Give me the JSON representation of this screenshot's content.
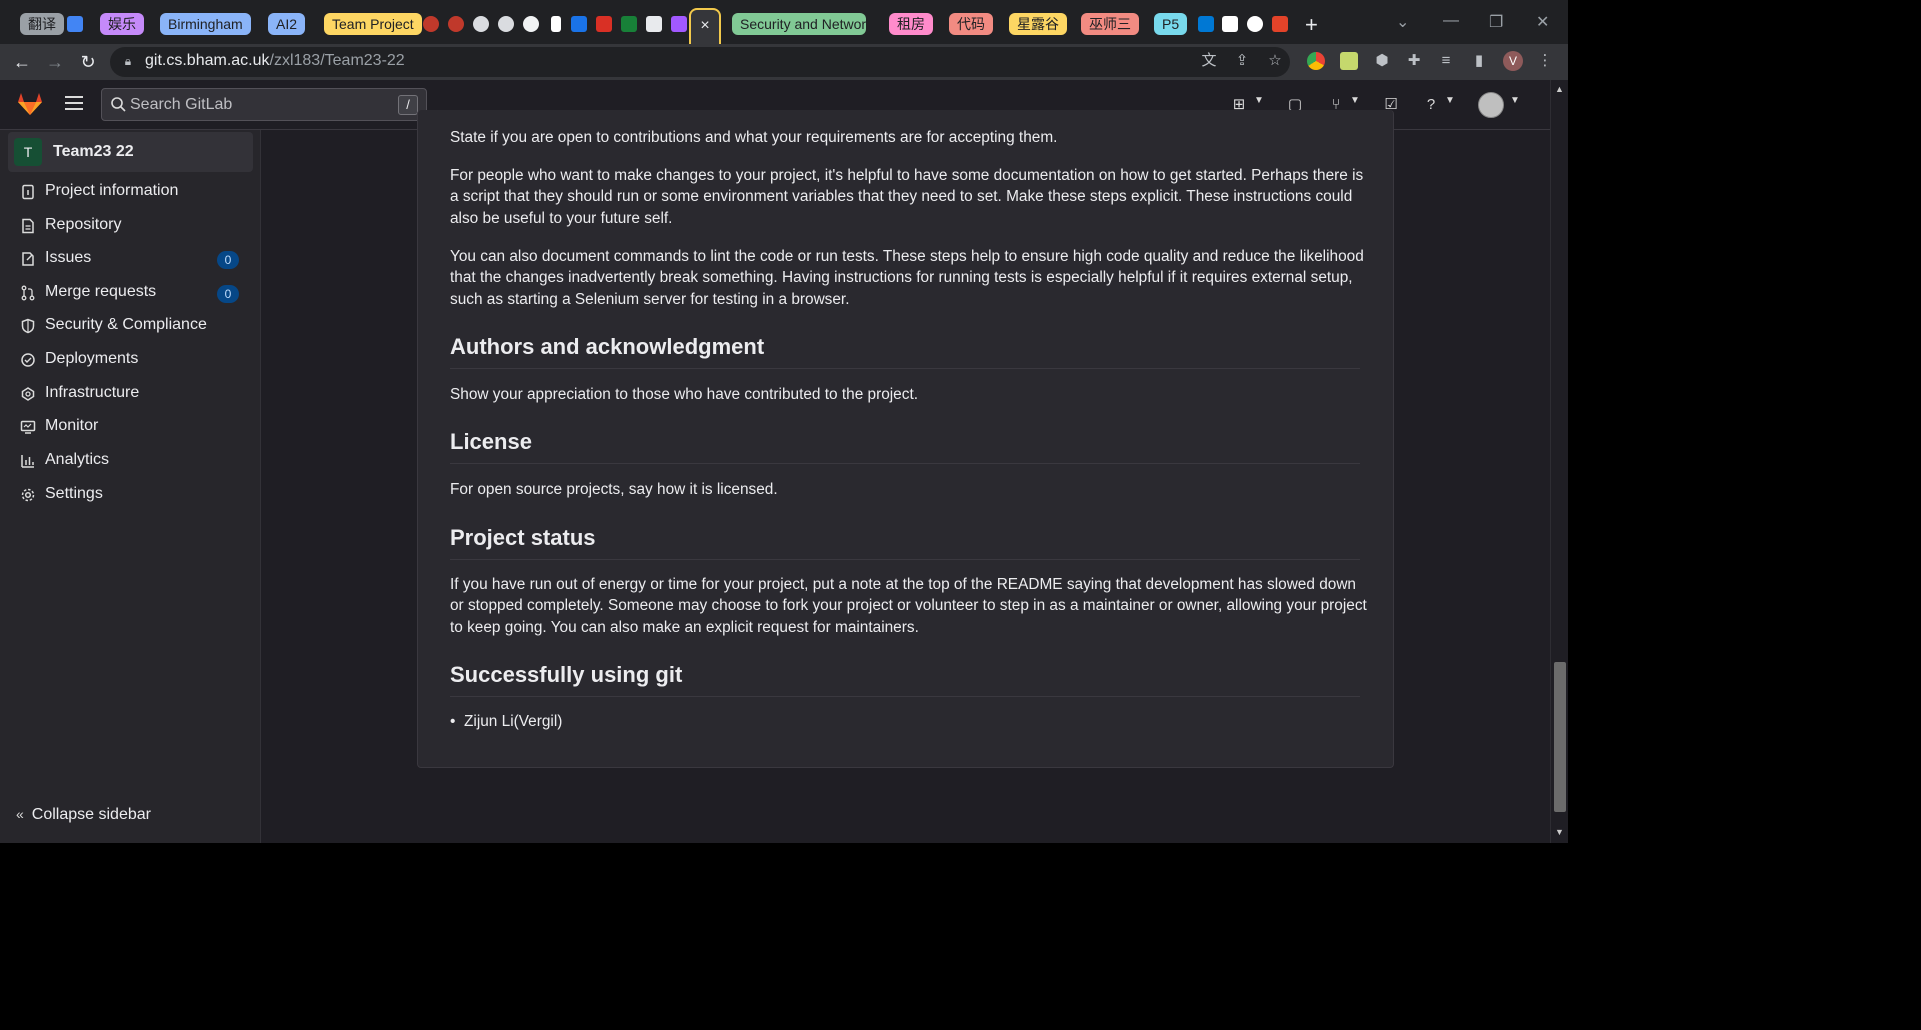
{
  "browser": {
    "tab_groups": [
      {
        "label": "翻译",
        "bg": "#9aa0a6",
        "underline": "#9aa0a6"
      },
      {
        "label": "娱乐",
        "bg": "#c58af9",
        "underline": "#c58af9"
      },
      {
        "label": "Birmingham",
        "bg": "#8ab4f8",
        "underline": "#8ab4f8"
      },
      {
        "label": "AI2",
        "bg": "#8ab4f8",
        "underline": "#8ab4f8"
      },
      {
        "label": "Team Project",
        "bg": "#fdd663",
        "underline": "#fdd663"
      },
      {
        "label": "Security and Networ",
        "bg": "#81c995",
        "underline": "#81c995"
      },
      {
        "label": "租房",
        "bg": "#ff8bcb",
        "underline": "#ff8bcb"
      },
      {
        "label": "代码",
        "bg": "#f28b82",
        "underline": "#f28b82"
      },
      {
        "label": "星露谷",
        "bg": "#fdd663",
        "underline": "#fdd663"
      },
      {
        "label": "巫师三",
        "bg": "#f28b82",
        "underline": "#f28b82"
      },
      {
        "label": "P5",
        "bg": "#78d9ec",
        "underline": "#78d9ec"
      }
    ],
    "active_tab_close": "×",
    "new_tab": "+",
    "window_controls": [
      "⌄",
      "—",
      "❐",
      "✕"
    ],
    "url_host": "git.cs.bham.ac.uk",
    "url_path": "/zxl183/Team23-22",
    "profile_initial": "V"
  },
  "gitlab": {
    "search_placeholder": "Search GitLab",
    "search_shortcut": "/",
    "project_avatar": "T",
    "project_name": "Team23 22",
    "nav": [
      {
        "label": "Project information",
        "icon": "project-icon"
      },
      {
        "label": "Repository",
        "icon": "document-icon"
      },
      {
        "label": "Issues",
        "icon": "issues-icon",
        "badge": "0"
      },
      {
        "label": "Merge requests",
        "icon": "merge-request-icon",
        "badge": "0"
      },
      {
        "label": "Security & Compliance",
        "icon": "shield-icon"
      },
      {
        "label": "Deployments",
        "icon": "deployments-icon"
      },
      {
        "label": "Infrastructure",
        "icon": "cloud-icon"
      },
      {
        "label": "Monitor",
        "icon": "monitor-icon"
      },
      {
        "label": "Analytics",
        "icon": "chart-icon"
      },
      {
        "label": "Settings",
        "icon": "gear-icon"
      }
    ],
    "collapse_label": "Collapse sidebar"
  },
  "readme": {
    "p_contrib": "State if you are open to contributions and what your requirements are for accepting them.",
    "p_docs": "For people who want to make changes to your project, it's helpful to have some documentation on how to get started. Perhaps there is a script that they should run or some environment variables that they need to set. Make these steps explicit. These instructions could also be useful to your future self.",
    "p_lint": "You can also document commands to lint the code or run tests. These steps help to ensure high code quality and reduce the likelihood that the changes inadvertently break something. Having instructions for running tests is especially helpful if it requires external setup, such as starting a Selenium server for testing in a browser.",
    "h_authors": "Authors and acknowledgment",
    "p_authors": "Show your appreciation to those who have contributed to the project.",
    "h_license": "License",
    "p_license": "For open source projects, say how it is licensed.",
    "h_status": "Project status",
    "p_status": "If you have run out of energy or time for your project, put a note at the top of the README saying that development has slowed down or stopped completely. Someone may choose to fork your project or volunteer to step in as a maintainer or owner, allowing your project to keep going. You can also make an explicit request for maintainers.",
    "h_git": "Successfully using git",
    "list": [
      "Zijun Li(Vergil)"
    ]
  }
}
